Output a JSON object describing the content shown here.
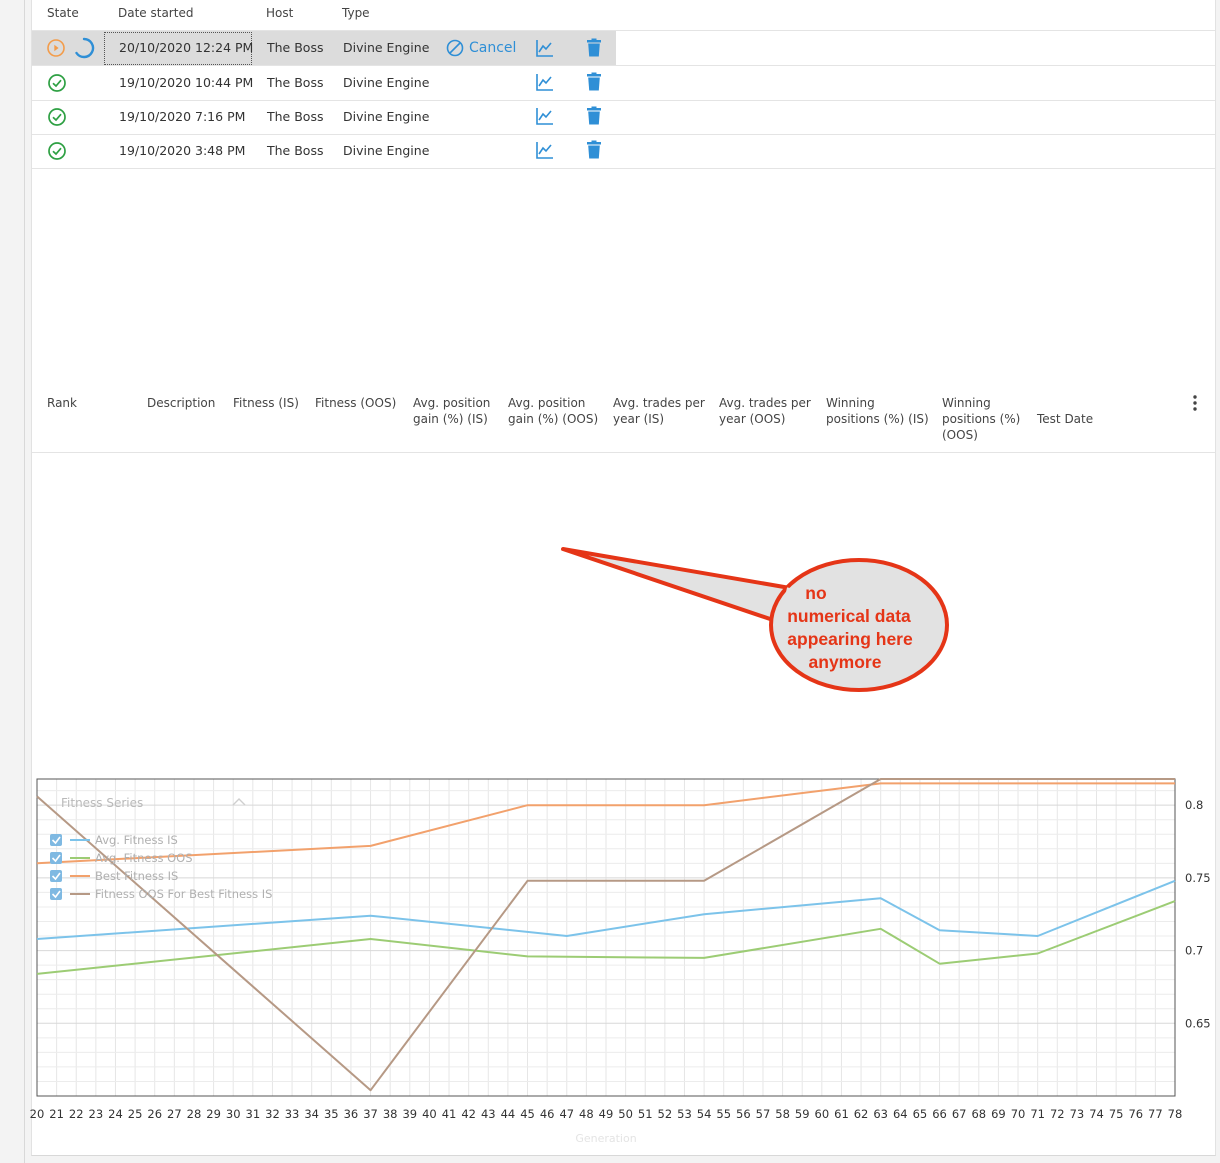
{
  "runs": {
    "headers": {
      "state": "State",
      "date": "Date started",
      "host": "Host",
      "type": "Type"
    },
    "rows": [
      {
        "state": "running",
        "date": "20/10/2020 12:24 PM",
        "host": "The Boss",
        "type": "Divine Engine",
        "cancel": "Cancel"
      },
      {
        "state": "done",
        "date": "19/10/2020 10:44 PM",
        "host": "The Boss",
        "type": "Divine Engine"
      },
      {
        "state": "done",
        "date": "19/10/2020 7:16 PM",
        "host": "The Boss",
        "type": "Divine Engine"
      },
      {
        "state": "done",
        "date": "19/10/2020 3:48 PM",
        "host": "The Boss",
        "type": "Divine Engine"
      }
    ],
    "icons": {
      "running": "play-circle-icon",
      "spinner": "spinner-icon",
      "done": "check-circle-icon",
      "cancel": "cancel-circle-icon",
      "chart": "line-chart-icon",
      "delete": "trash-icon"
    }
  },
  "results": {
    "headers": {
      "rank": "Rank",
      "description": "Description",
      "fitness_is": "Fitness (IS)",
      "fitness_oos": "Fitness (OOS)",
      "avg_gain_is": [
        "Avg. position",
        "gain (%) (IS)"
      ],
      "avg_gain_oos": [
        "Avg. position",
        "gain (%) (OOS)"
      ],
      "trades_is": [
        "Avg. trades per",
        "year (IS)"
      ],
      "trades_oos": [
        "Avg. trades per",
        "year (OOS)"
      ],
      "win_is": [
        "Winning",
        "positions (%) (IS)"
      ],
      "win_oos": [
        "Winning",
        "positions (%)",
        "(OOS)"
      ],
      "test_date": "Test Date"
    },
    "menu_icon": "kebab-menu-icon"
  },
  "annotation": {
    "lines": [
      "no",
      "numerical data",
      "appearing here",
      "anymore"
    ]
  },
  "colors": {
    "accent": "#2f8fd6",
    "success": "#2ea043",
    "running": "#f39c4a",
    "annotation": "#e53517"
  },
  "chart_data": {
    "type": "line",
    "legend_title": "Fitness Series",
    "legend_placement": "top-left",
    "xlabel": "Generation",
    "ylabel": "",
    "x": [
      20,
      21,
      22,
      23,
      24,
      25,
      26,
      27,
      28,
      29,
      30,
      31,
      32,
      33,
      34,
      35,
      36,
      37,
      38,
      39,
      40,
      41,
      42,
      43,
      44,
      45,
      46,
      47,
      48,
      49,
      50,
      51,
      52,
      53,
      54,
      55,
      56,
      57,
      58,
      59,
      60,
      61,
      62,
      63,
      64,
      65,
      66,
      67,
      68,
      69,
      70,
      71,
      72,
      73,
      74,
      75,
      76,
      77,
      78
    ],
    "xlim": [
      20,
      78
    ],
    "ylim": [
      0.6,
      0.818
    ],
    "yticks": [
      0.65,
      0.7,
      0.75,
      0.8
    ],
    "grid": true,
    "series": [
      {
        "name": "Avg. Fitness IS",
        "color": "#7cc3ea",
        "points": [
          [
            20,
            0.708
          ],
          [
            37,
            0.724
          ],
          [
            47,
            0.71
          ],
          [
            54,
            0.725
          ],
          [
            63,
            0.736
          ],
          [
            66,
            0.714
          ],
          [
            71,
            0.71
          ],
          [
            78,
            0.748
          ]
        ]
      },
      {
        "name": "Avg. Fitness OOS",
        "color": "#9ccc74",
        "points": [
          [
            20,
            0.684
          ],
          [
            37,
            0.708
          ],
          [
            45,
            0.696
          ],
          [
            54,
            0.695
          ],
          [
            63,
            0.715
          ],
          [
            66,
            0.691
          ],
          [
            71,
            0.698
          ],
          [
            78,
            0.734
          ]
        ]
      },
      {
        "name": "Best Fitness IS",
        "color": "#f2a16c",
        "points": [
          [
            20,
            0.76
          ],
          [
            37,
            0.772
          ],
          [
            45,
            0.8
          ],
          [
            54,
            0.8
          ],
          [
            63,
            0.815
          ],
          [
            78,
            0.815
          ]
        ]
      },
      {
        "name": "Fitness OOS For Best Fitness IS",
        "color": "#b69985",
        "points": [
          [
            20,
            0.806
          ],
          [
            37,
            0.604
          ],
          [
            45,
            0.748
          ],
          [
            54,
            0.748
          ],
          [
            63,
            0.818
          ],
          [
            78,
            0.818
          ]
        ]
      }
    ]
  }
}
